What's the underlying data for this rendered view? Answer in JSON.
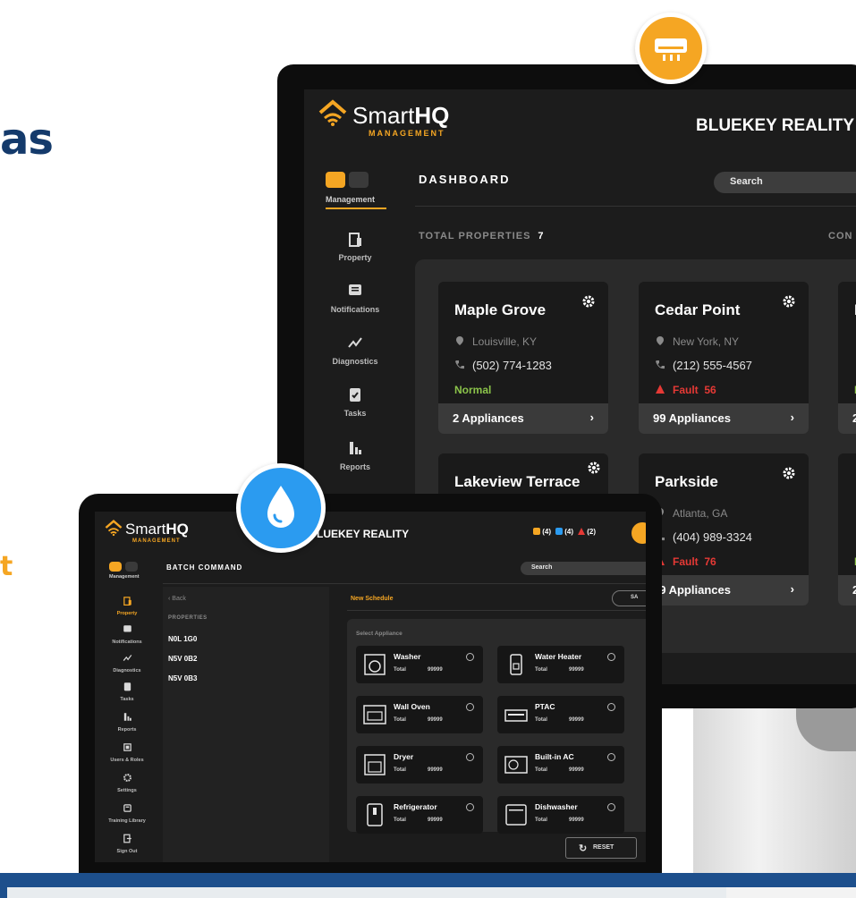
{
  "marketing": {
    "headline_fragment": "as",
    "accent_fragment": "t"
  },
  "monitor": {
    "brand": {
      "name_light": "Smart",
      "name_bold": "HQ",
      "subtitle": "MANAGEMENT"
    },
    "company": "BLUEKEY REALITY",
    "page_title": "DASHBOARD",
    "search_placeholder": "Search",
    "total_properties_label": "TOTAL PROPERTIES",
    "total_properties_value": "7",
    "connected_label": "CON",
    "sidebar": {
      "toggle_label": "Management",
      "items": [
        {
          "label": "Property",
          "icon": "building-icon"
        },
        {
          "label": "Notifications",
          "icon": "message-icon"
        },
        {
          "label": "Diagnostics",
          "icon": "diagnostics-icon"
        },
        {
          "label": "Tasks",
          "icon": "clipboard-icon"
        },
        {
          "label": "Reports",
          "icon": "bar-chart-icon"
        }
      ]
    },
    "properties": [
      {
        "name": "Maple Grove",
        "location": "Louisville, KY",
        "phone": "(502) 774-1283",
        "status": "Normal",
        "fault_count": "",
        "appliances": "2 Appliances"
      },
      {
        "name": "Cedar Point",
        "location": "New York, NY",
        "phone": "(212) 555-4567",
        "status": "Fault",
        "fault_count": "56",
        "appliances": "99 Appliances"
      },
      {
        "name": "Lakeview Terrace",
        "location": "",
        "phone": "",
        "status": "",
        "fault_count": "",
        "appliances": ""
      },
      {
        "name": "Parkside",
        "location": "Atlanta, GA",
        "phone": "(404) 989-3324",
        "status": "Fault",
        "fault_count": "76",
        "appliances": "99 Appliances"
      },
      {
        "name": "B",
        "location": "",
        "phone": "",
        "status": "N",
        "fault_count": "",
        "appliances": "2"
      },
      {
        "name": "",
        "location": "",
        "phone": "",
        "status": "N",
        "fault_count": "",
        "appliances": "2"
      }
    ]
  },
  "laptop": {
    "brand": {
      "name_light": "Smart",
      "name_bold": "HQ",
      "subtitle": "MANAGEMENT"
    },
    "company": "BLUEKEY REALITY",
    "company_visible": "LUEKEY REALITY",
    "stats": [
      {
        "count": "(4)",
        "color": "#f5a623"
      },
      {
        "count": "(4)",
        "color": "#2b9bf0"
      },
      {
        "count": "(2)",
        "color": "#e53935"
      }
    ],
    "page_title": "BATCH COMMAND",
    "search_placeholder": "Search",
    "back_label": "Back",
    "properties_label": "PROPERTIES",
    "properties": [
      "N0L 1G0",
      "N5V 0B2",
      "N5V 0B3"
    ],
    "new_schedule_label": "New Schedule",
    "save_label": "SA",
    "select_appliance_label": "Select Appliance",
    "total_label": "Total",
    "appliances": [
      {
        "name": "Washer",
        "total": "99999",
        "icon": "washer-icon"
      },
      {
        "name": "Water Heater",
        "total": "99999",
        "icon": "water-heater-icon"
      },
      {
        "name": "Wall Oven",
        "total": "99999",
        "icon": "wall-oven-icon"
      },
      {
        "name": "PTAC",
        "total": "99999",
        "icon": "ptac-icon"
      },
      {
        "name": "Dryer",
        "total": "99999",
        "icon": "dryer-icon"
      },
      {
        "name": "Built-in AC",
        "total": "99999",
        "icon": "built-in-ac-icon"
      },
      {
        "name": "Refrigerator",
        "total": "99999",
        "icon": "refrigerator-icon"
      },
      {
        "name": "Dishwasher",
        "total": "99999",
        "icon": "dishwasher-icon"
      }
    ],
    "reset_label": "RESET",
    "sidebar": {
      "toggle_label": "Management",
      "items": [
        {
          "label": "Property",
          "icon": "building-icon"
        },
        {
          "label": "Notifications",
          "icon": "message-icon"
        },
        {
          "label": "Diagnostics",
          "icon": "diagnostics-icon"
        },
        {
          "label": "Tasks",
          "icon": "clipboard-icon"
        },
        {
          "label": "Reports",
          "icon": "bar-chart-icon"
        },
        {
          "label": "Users & Roles",
          "icon": "users-icon"
        },
        {
          "label": "Settings",
          "icon": "gear-icon"
        },
        {
          "label": "Training Library",
          "icon": "library-icon"
        },
        {
          "label": "Sign Out",
          "icon": "sign-out-icon"
        }
      ]
    }
  },
  "colors": {
    "accent": "#f5a623",
    "normal": "#8bc34a",
    "fault": "#e53935",
    "water": "#2b9bf0",
    "brand_blue": "#143a6b"
  }
}
